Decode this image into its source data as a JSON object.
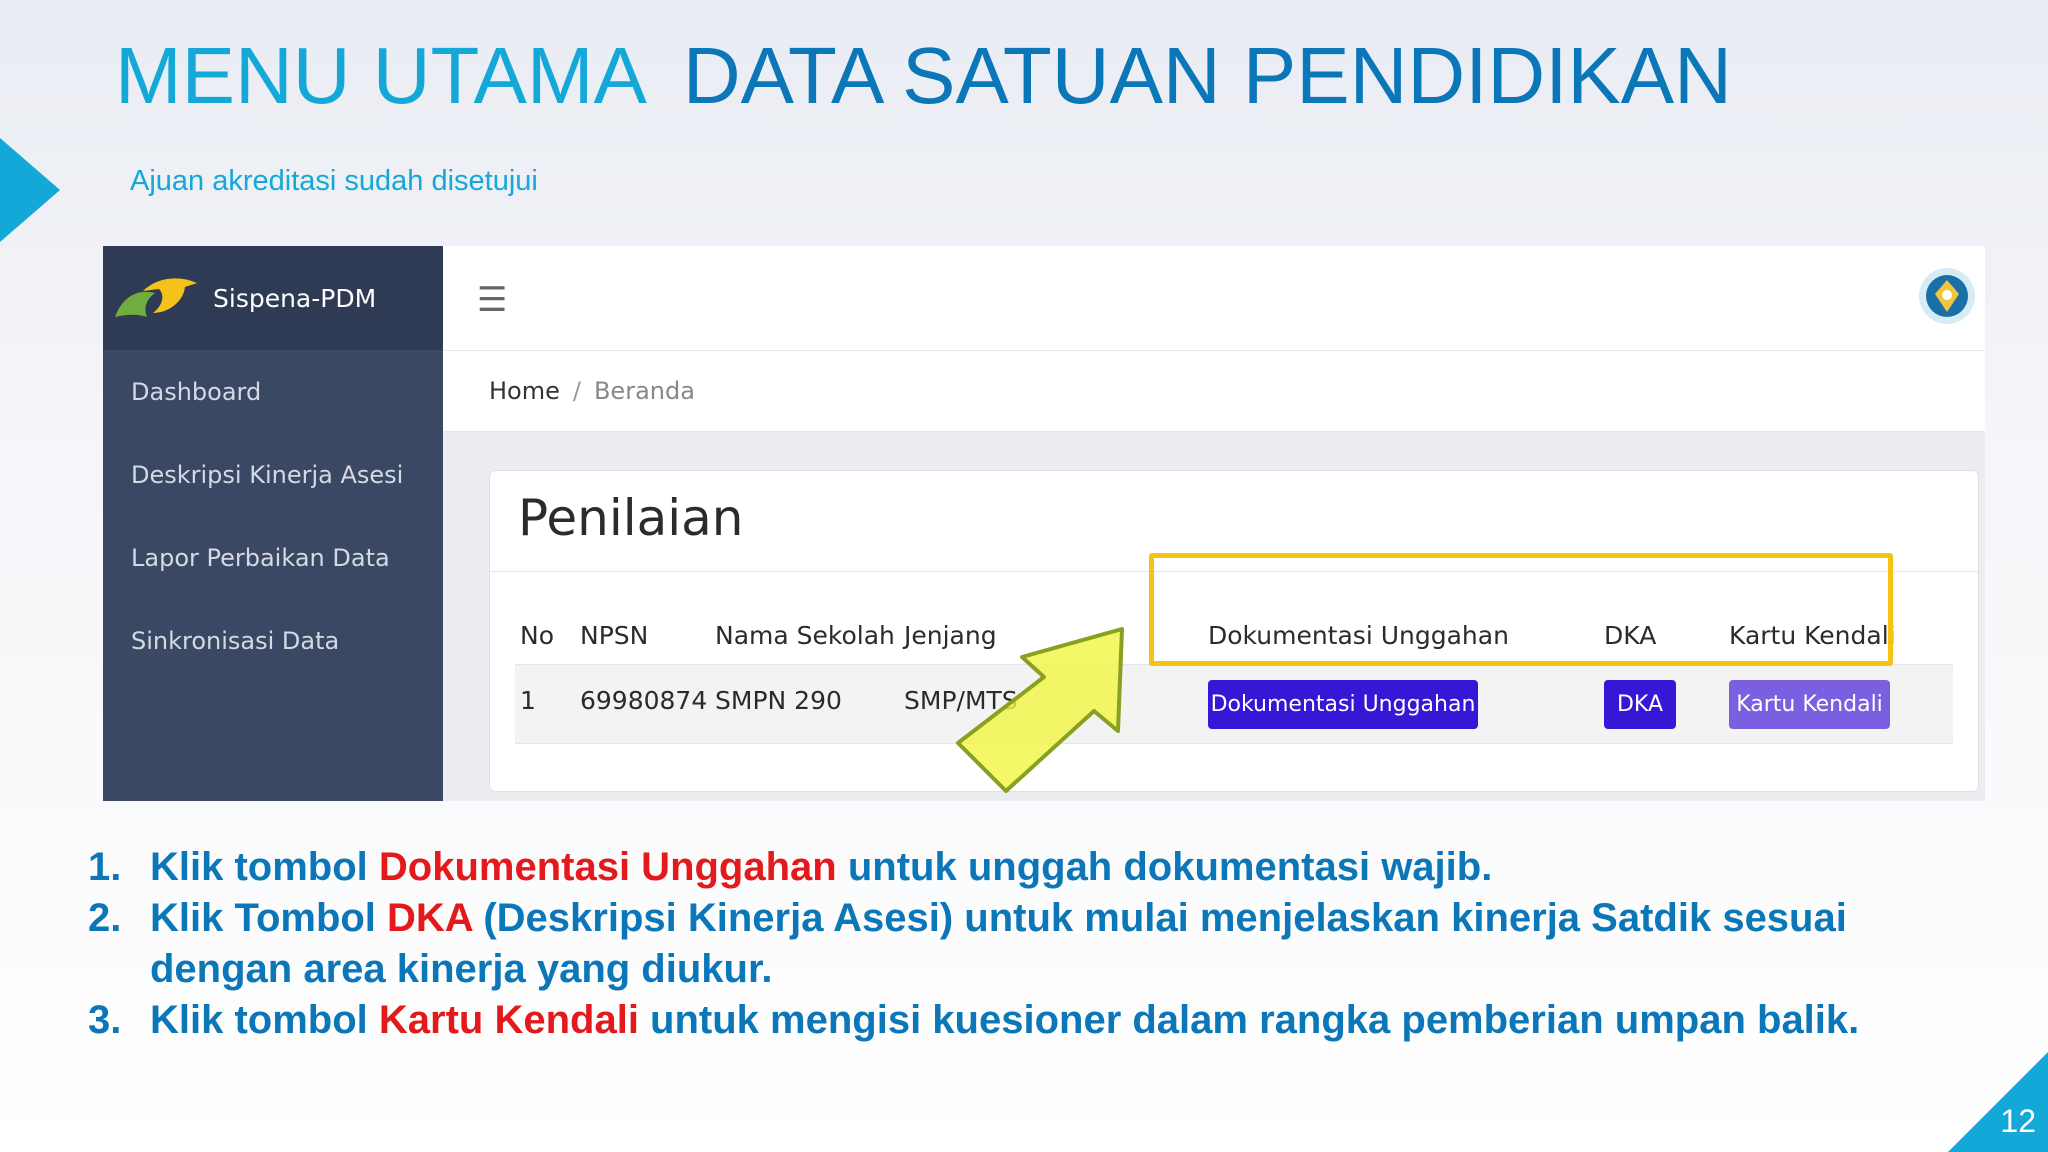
{
  "slide": {
    "title_part1": "MENU UTAMA",
    "title_part2": "DATA SATUAN PENDIDIKAN",
    "subtitle": "Ajuan akreditasi sudah disetujui",
    "page_number": "12",
    "accent_color": "#14a8d8",
    "title_color": "#0b76b8"
  },
  "app": {
    "brand": "Sispena-PDM",
    "sidebar": {
      "items": [
        {
          "label": "Dashboard"
        },
        {
          "label": "Deskripsi Kinerja Asesi"
        },
        {
          "label": "Lapor Perbaikan Data"
        },
        {
          "label": "Sinkronisasi Data"
        }
      ]
    },
    "topbar": {
      "menu_icon": "hamburger-icon",
      "avatar_icon": "emblem-icon"
    },
    "breadcrumb": {
      "home": "Home",
      "separator": "/",
      "current": "Beranda"
    },
    "card": {
      "title": "Penilaian",
      "columns": [
        "No",
        "NPSN",
        "Nama Sekolah",
        "Jenjang",
        "Dokumentasi Unggahan",
        "DKA",
        "Kartu Kendali"
      ],
      "rows": [
        {
          "no": "1",
          "npsn": "69980874",
          "nama_sekolah": "SMPN 290",
          "jenjang": "SMP/MTS",
          "btn_dokumentasi": "Dokumentasi Unggahan",
          "btn_dka": "DKA",
          "btn_kartu": "Kartu Kendali"
        }
      ]
    },
    "colors": {
      "sidebar": "#3b4863",
      "button_primary": "#3418d6",
      "button_secondary": "#7a5fe0",
      "highlight": "#f4c316",
      "arrow": "#f0f542"
    }
  },
  "instructions": [
    {
      "num": "1.",
      "before": "Klik tombol ",
      "highlight": "Dokumentasi Unggahan",
      "after": " untuk unggah dokumentasi wajib."
    },
    {
      "num": "2.",
      "before": "Klik Tombol ",
      "highlight": "DKA",
      "after": " (Deskripsi Kinerja Asesi) untuk mulai menjelaskan kinerja Satdik sesuai dengan area kinerja yang diukur."
    },
    {
      "num": "3.",
      "before": "Klik tombol ",
      "highlight": "Kartu Kendali",
      "after": " untuk mengisi kuesioner dalam rangka pemberian umpan balik."
    }
  ]
}
